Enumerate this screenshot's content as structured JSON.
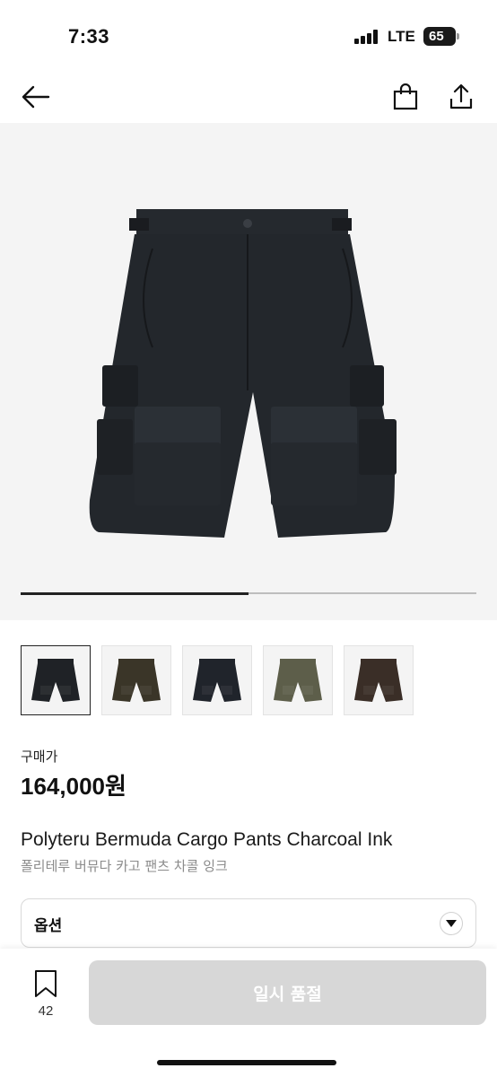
{
  "status_bar": {
    "time": "7:33",
    "network": "LTE",
    "battery": "65"
  },
  "nav": {
    "back_icon": "arrow-left-icon",
    "cart_icon": "shopping-bag-icon",
    "share_icon": "share-icon"
  },
  "gallery": {
    "progress": 0.5,
    "thumbnails": [
      {
        "color": "#1f2226",
        "label": "charcoal-ink"
      },
      {
        "color": "#3a3528",
        "label": "olive-dark"
      },
      {
        "color": "#20242b",
        "label": "navy-black"
      },
      {
        "color": "#5d5e4a",
        "label": "olive"
      },
      {
        "color": "#3a2e27",
        "label": "brown"
      }
    ]
  },
  "product": {
    "price_label": "구매가",
    "price": "164,000원",
    "title_en": "Polyteru Bermuda Cargo Pants Charcoal Ink",
    "title_ko": "폴리테루 버뮤다 카고 팬츠 차콜 잉크"
  },
  "option": {
    "label": "옵션",
    "icon": "chevron-down-icon"
  },
  "bottom_bar": {
    "bookmark_count": "42",
    "action_label": "일시 품절"
  },
  "colors": {
    "accent": "#222222",
    "disabled": "#d7d7d7",
    "subtext": "#8b8b8b"
  }
}
